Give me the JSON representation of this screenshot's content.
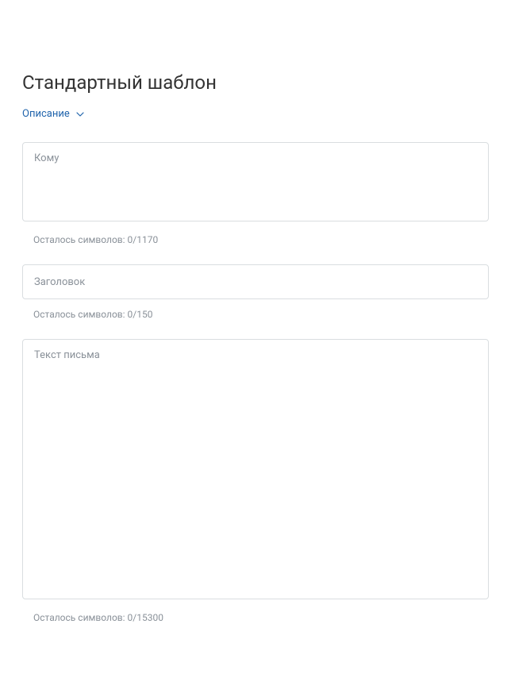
{
  "page": {
    "title": "Стандартный шаблон"
  },
  "toggle": {
    "label": "Описание"
  },
  "fields": {
    "to": {
      "placeholder": "Кому",
      "counter": "Осталось символов: 0/1170"
    },
    "subject": {
      "placeholder": "Заголовок",
      "counter": "Осталось символов: 0/150"
    },
    "body": {
      "placeholder": "Текст письма",
      "counter": "Осталось символов: 0/15300"
    }
  }
}
